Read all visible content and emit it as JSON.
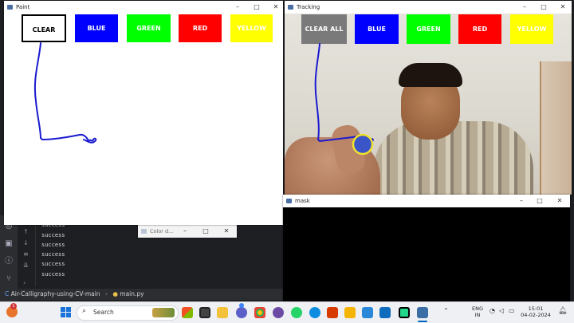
{
  "paint_window": {
    "title": "Paint",
    "buttons": [
      "CLEAR",
      "BLUE",
      "GREEN",
      "RED",
      "YELLOW"
    ]
  },
  "tracking_window": {
    "title": "Tracking",
    "buttons": [
      "CLEAR ALL",
      "BLUE",
      "GREEN",
      "RED",
      "YELLOW"
    ]
  },
  "mask_window": {
    "title": "mask"
  },
  "color_window": {
    "title": "Color d..."
  },
  "ide": {
    "output_lines": [
      "success",
      "success",
      "success",
      "success",
      "success",
      "success"
    ],
    "breadcrumb_project": "Air-Calligraphy-using-CV-main",
    "breadcrumb_file": "main.py"
  },
  "taskbar": {
    "search_placeholder": "Search",
    "notification_count": "1",
    "lang_top": "ENG",
    "lang_bottom": "IN",
    "time": "15:01",
    "date": "04-02-2024"
  },
  "colors": {
    "blue": "#0000ff",
    "green": "#00ff00",
    "red": "#ff0000",
    "yellow": "#ffff00",
    "clear_all_gray": "#7a7a7a",
    "stroke_blue": "#1b1bd0"
  },
  "icons": {
    "minimize": "minimize-icon",
    "maximize": "maximize-icon",
    "close": "close-icon"
  }
}
